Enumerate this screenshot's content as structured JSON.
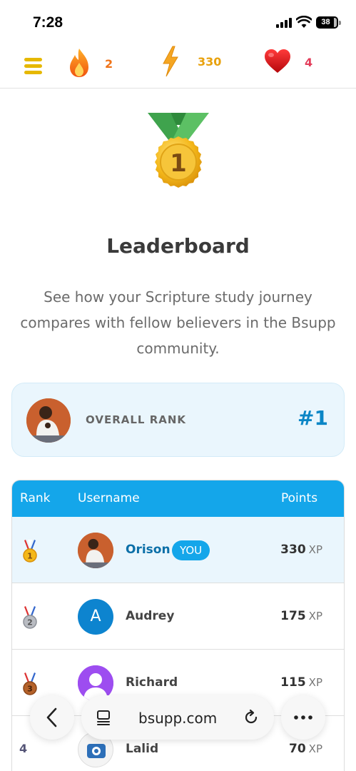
{
  "status_bar": {
    "time": "7:28",
    "battery": "38"
  },
  "app_bar": {
    "streak": {
      "icon": "flame-icon",
      "value": "2",
      "color": "#f07318"
    },
    "xp": {
      "icon": "lightning-icon",
      "value": "330",
      "color": "#e8a10c"
    },
    "lives": {
      "icon": "heart-icon",
      "value": "4",
      "color": "#e33d5a"
    }
  },
  "hero": {
    "icon": "gold-medal-icon",
    "medal_number": "1",
    "title": "Leaderboard",
    "subtitle": "See how your Scripture study journey compares with fellow believers in the Bsupp community."
  },
  "rank_card": {
    "label": "OVERALL RANK",
    "value": "#1"
  },
  "leaderboard": {
    "headers": {
      "rank": "Rank",
      "username": "Username",
      "points": "Points"
    },
    "rows": [
      {
        "rank": "1",
        "rank_icon": "gold-medal-icon",
        "name": "Orison",
        "badge": "YOU",
        "points": "330",
        "unit": "XP"
      },
      {
        "rank": "2",
        "rank_icon": "silver-medal-icon",
        "name": "Audrey",
        "avatar_letter": "A",
        "points": "175",
        "unit": "XP"
      },
      {
        "rank": "3",
        "rank_icon": "bronze-medal-icon",
        "name": "Richard",
        "points": "115",
        "unit": "XP"
      },
      {
        "rank": "4",
        "name": "Lalid",
        "points": "70",
        "unit": "XP"
      }
    ]
  },
  "browser": {
    "url": "bsupp.com"
  },
  "colors": {
    "accent": "#14a6ea",
    "rank_blue": "#0b86c6",
    "card_bg": "#eaf6fd"
  }
}
